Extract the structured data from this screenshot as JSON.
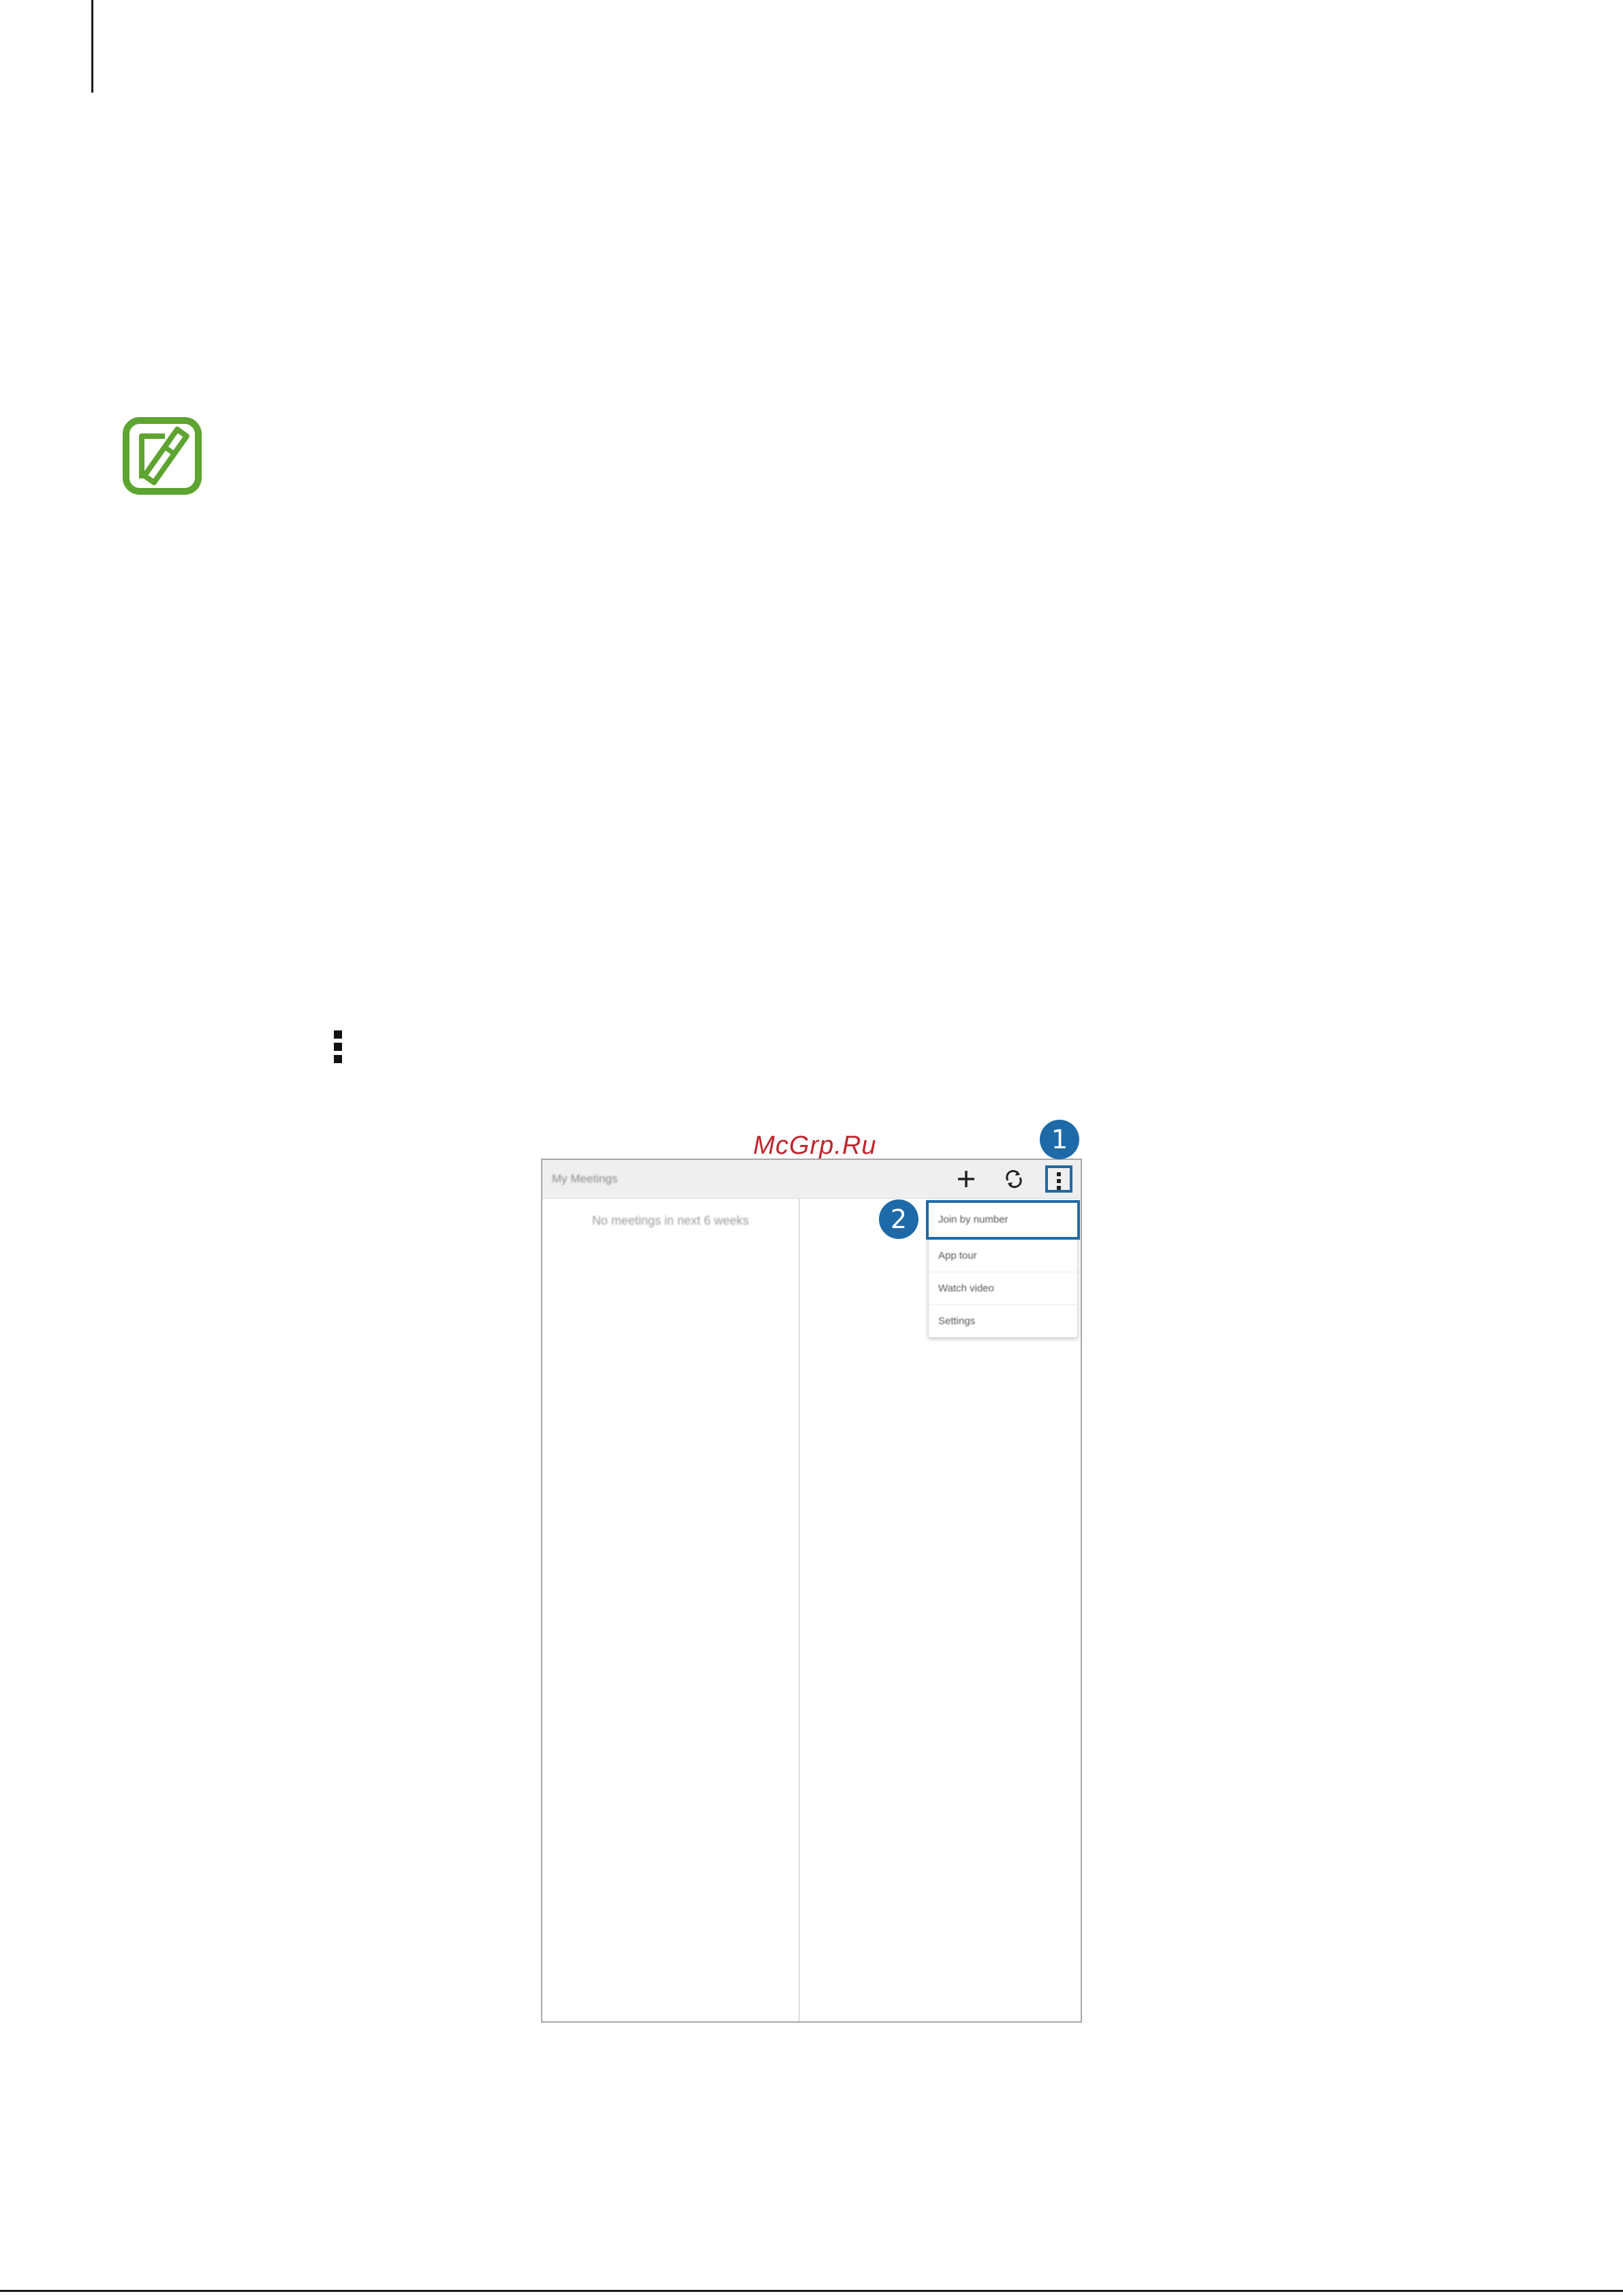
{
  "watermark": "McGrp.Ru",
  "screen": {
    "title": "My Meetings",
    "empty_message": "No meetings in next 6 weeks",
    "icons": {
      "add": "plus-icon",
      "refresh": "refresh-icon",
      "more": "more-options-icon"
    },
    "menu": [
      {
        "label": "Join by number",
        "highlighted": true
      },
      {
        "label": "App tour",
        "highlighted": false
      },
      {
        "label": "Watch video",
        "highlighted": false
      },
      {
        "label": "Settings",
        "highlighted": false
      }
    ]
  },
  "callouts": {
    "one": "1",
    "two": "2"
  },
  "colors": {
    "callout": "#1e6aa8",
    "note_icon": "#5ea431",
    "watermark": "#c0262c"
  }
}
